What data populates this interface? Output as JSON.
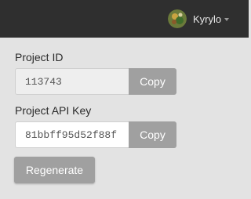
{
  "header": {
    "username": "Kyrylo",
    "avatar_icon": "user-avatar-icon",
    "dropdown_icon": "chevron-down-icon"
  },
  "project_id": {
    "label": "Project ID",
    "value": "113743",
    "copy_label": "Copy"
  },
  "api_key": {
    "label": "Project API Key",
    "value": "81bbff95d52f88f",
    "copy_label": "Copy"
  },
  "regenerate_label": "Regenerate",
  "colors": {
    "topbar": "#2f2f2f",
    "background": "#e3e3e3",
    "button": "#a0a0a0",
    "button_text": "#ffffff"
  }
}
